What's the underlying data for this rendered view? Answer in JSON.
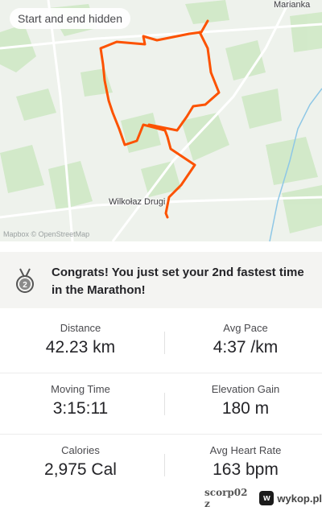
{
  "map": {
    "chip": "Start and end hidden",
    "towns": [
      "Marianka",
      "Wilkołaz Drugi"
    ],
    "attribution": "Mapbox © OpenStreetMap",
    "route_color": "#fc5200"
  },
  "congrats": {
    "icon": "medal-icon",
    "text": "Congrats! You just set your 2nd fastest time in the Marathon!"
  },
  "stats": {
    "distance": {
      "label": "Distance",
      "value": "42.23 km"
    },
    "avg_pace": {
      "label": "Avg Pace",
      "value": "4:37 /km"
    },
    "moving_time": {
      "label": "Moving Time",
      "value": "3:15:11"
    },
    "elevation_gain": {
      "label": "Elevation Gain",
      "value": "180 m"
    },
    "calories": {
      "label": "Calories",
      "value": "2,975 Cal"
    },
    "avg_heart_rate": {
      "label": "Avg Heart Rate",
      "value": "163 bpm"
    }
  },
  "watermark": {
    "user": "scorp02 z",
    "logo": "w",
    "site": "wykop.pl"
  }
}
